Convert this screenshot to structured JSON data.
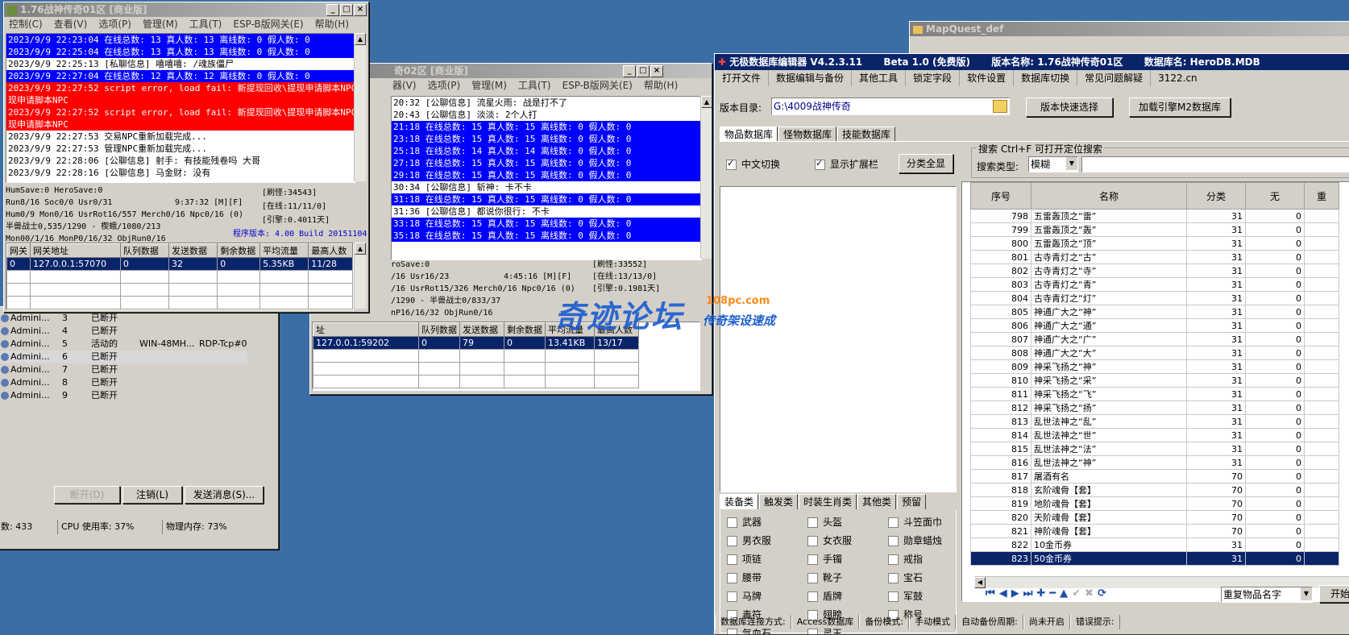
{
  "win1": {
    "title": "1.76战神传奇01区 [商业版]",
    "menu": [
      "控制(C)",
      "查看(V)",
      "选项(P)",
      "管理(M)",
      "工具(T)",
      "ESP-B版网关(E)",
      "帮助(H)"
    ],
    "log": [
      {
        "t": "2023/9/9 22:23:04 在线总数: 13 真人数: 13 离线数: 0 假人数: 0",
        "c": "blue"
      },
      {
        "t": "2023/9/9 22:25:04 在线总数: 13 真人数: 13 离线数: 0 假人数: 0",
        "c": "blue"
      },
      {
        "t": "2023/9/9 22:25:13 [私聊信息] 嘻嘻嘻: /魂族僵尸",
        "c": ""
      },
      {
        "t": "2023/9/9 22:27:04 在线总数: 12 真人数: 12 离线数: 0 假人数: 0",
        "c": "blue"
      },
      {
        "t": "2023/9/9 22:27:52 script error, load fail: 新提现回收\\提现申请脚本NPC.txt@提",
        "c": "red"
      },
      {
        "t": "现申请脚本NPC",
        "c": "red"
      },
      {
        "t": "2023/9/9 22:27:52 script error, load fail: 新提现回收\\提现申请脚本NPC.txt@提",
        "c": "red"
      },
      {
        "t": "现申请脚本NPC",
        "c": "red"
      },
      {
        "t": "2023/9/9 22:27:53 交易NPC重新加载完成...",
        "c": ""
      },
      {
        "t": "2023/9/9 22:27:53 管理NPC重新加载完成...",
        "c": ""
      },
      {
        "t": "2023/9/9 22:28:06 [公聊信息] 射手: 有技能残卷吗 大哥",
        "c": ""
      },
      {
        "t": "2023/9/9 22:28:16 [公聊信息] 马金财: 没有",
        "c": ""
      }
    ],
    "stats": [
      "HumSave:0 HeroSave:0",
      "Run8/16 Soc0/0 Usr0/31",
      "Hum0/9 Mon0/16 UsrRot16/557 Merch0/16 Npc0/16 (0)",
      "半兽战士0,535/1290 - 楔蛾/1080/213",
      "Mon00/1/16 MonP0/16/32 ObjRun0/16"
    ],
    "time": "9:37:32 [M][F]",
    "refresh": "[刷怪:34543]",
    "online": "[在线:11/11/0]",
    "engine": "[引擎:0.4011天]",
    "version": "程序版本: 4.00 Build 20151104",
    "gw_headers": [
      "网关",
      "网关地址",
      "队列数据",
      "发送数据",
      "剩余数据",
      "平均流量",
      "最高人数"
    ],
    "gw_row": [
      "0",
      "127.0.0.1:57070",
      "0",
      "32",
      "0",
      "5.35KB",
      "11/28"
    ]
  },
  "win2": {
    "title": "奇02区 [商业版]",
    "menu": [
      "器(V)",
      "选项(P)",
      "管理(M)",
      "工具(T)",
      "ESP-B版网关(E)",
      "帮助(H)"
    ],
    "log": [
      {
        "t": "20:32 [公聊信息] 流星火雨: 战是打不了",
        "c": ""
      },
      {
        "t": "20:43 [公聊信息] 淡淡: 2个人打",
        "c": ""
      },
      {
        "t": "21:18 在线总数: 15 真人数: 15 离线数: 0 假人数: 0",
        "c": "blue"
      },
      {
        "t": "23:18 在线总数: 15 真人数: 15 离线数: 0 假人数: 0",
        "c": "blue"
      },
      {
        "t": "25:18 在线总数: 14 真人数: 14 离线数: 0 假人数: 0",
        "c": "blue"
      },
      {
        "t": "27:18 在线总数: 15 真人数: 15 离线数: 0 假人数: 0",
        "c": "blue"
      },
      {
        "t": "29:18 在线总数: 15 真人数: 15 离线数: 0 假人数: 0",
        "c": "blue"
      },
      {
        "t": "30:34 [公聊信息] 斩神: 卡不卡",
        "c": ""
      },
      {
        "t": "31:18 在线总数: 15 真人数: 15 离线数: 0 假人数: 0",
        "c": "blue"
      },
      {
        "t": "31:36 [公聊信息] 都说你很行: 不卡",
        "c": ""
      },
      {
        "t": "33:18 在线总数: 15 真人数: 15 离线数: 0 假人数: 0",
        "c": "blue"
      },
      {
        "t": "35:18 在线总数: 15 真人数: 15 离线数: 0 假人数: 0",
        "c": "blue"
      }
    ],
    "stats": [
      "roSave:0",
      "/16 Usr16/23",
      "/16 UsrRot15/326 Merch0/16 Npc0/16 (0)",
      "/1290 - 半兽战士0/833/37",
      "nP16/16/32 ObjRun0/16"
    ],
    "time": "4:45:16 [M][F]",
    "refresh": "[刷怪:33552]",
    "online": "[在线:13/13/0]",
    "engine": "[引擎:0.1981天]",
    "gw_headers": [
      "址",
      "队列数据",
      "发送数据",
      "剩余数据",
      "平均流量",
      "最高人数"
    ],
    "gw_row": [
      "127.0.0.1:59202",
      "0",
      "79",
      "0",
      "13.41KB",
      "13/17"
    ]
  },
  "win3": {
    "sessions": [
      {
        "user": "Admini...",
        "id": "3",
        "state": "已断开",
        "client": "",
        "proto": ""
      },
      {
        "user": "Admini...",
        "id": "4",
        "state": "已断开",
        "client": "",
        "proto": ""
      },
      {
        "user": "Admini...",
        "id": "5",
        "state": "活动的",
        "client": "WIN-48MH...",
        "proto": "RDP-Tcp#0"
      },
      {
        "user": "Admini...",
        "id": "6",
        "state": "已断开",
        "client": "",
        "proto": ""
      },
      {
        "user": "Admini...",
        "id": "7",
        "state": "已断开",
        "client": "",
        "proto": ""
      },
      {
        "user": "Admini...",
        "id": "8",
        "state": "已断开",
        "client": "",
        "proto": ""
      },
      {
        "user": "Admini...",
        "id": "9",
        "state": "已断开",
        "client": "",
        "proto": ""
      }
    ],
    "btn_disconnect": "断开(D)",
    "btn_logoff": "注销(L)",
    "btn_send": "发送消息(S)...",
    "status_count": "数: 433",
    "status_cpu": "CPU 使用率: 37%",
    "status_mem": "物理内存: 73%"
  },
  "mapquest": {
    "title": "MapQuest_def"
  },
  "watermark": {
    "main": "奇迹论坛",
    "url": "108pc.com",
    "sub": "传奇架设速成"
  },
  "editor": {
    "title": "无极数据库编辑器 V4.2.3.11",
    "beta": "Beta 1.0 (免费版)",
    "ver_name": "版本名称: 1.76战神传奇01区",
    "db_name": "数据库名: HeroDB.MDB",
    "menu": [
      "打开文件",
      "数据编辑与备份",
      "其他工具",
      "锁定字段",
      "软件设置",
      "数据库切换",
      "常见问题解疑",
      "3122.cn"
    ],
    "dir_label": "版本目录:",
    "dir_value": "G:\\4009战神传奇",
    "btn_quick": "版本快速选择",
    "btn_load": "加载引擎M2数据库",
    "tabs": [
      "物品数据库",
      "怪物数据库",
      "技能数据库"
    ],
    "chk_cn": "中文切换",
    "chk_ext": "显示扩展栏",
    "btn_all": "分类全显",
    "search_legend": "搜索  Ctrl+F 可打开定位搜索",
    "search_type_label": "搜索类型:",
    "search_type": "模糊",
    "cat_tabs": [
      "装备类",
      "触发类",
      "时装生肖类",
      "其他类",
      "预留"
    ],
    "categories": [
      "武器",
      "头盔",
      "斗笠面巾",
      "男衣服",
      "女衣服",
      "勋章蜡烛",
      "项链",
      "手镯",
      "戒指",
      "腰带",
      "靴子",
      "宝石",
      "马牌",
      "盾牌",
      "军鼓",
      "毒符",
      "翅膀",
      "称号",
      "气血石",
      "灵玉"
    ],
    "cols": [
      "序号",
      "名称",
      "分类",
      "无",
      "重"
    ],
    "rows": [
      [
        "798",
        "五雷轰顶之“雷”",
        "31",
        "0"
      ],
      [
        "799",
        "五雷轰顶之“轰”",
        "31",
        "0"
      ],
      [
        "800",
        "五雷轰顶之“顶”",
        "31",
        "0"
      ],
      [
        "801",
        "古寺青灯之“古”",
        "31",
        "0"
      ],
      [
        "802",
        "古寺青灯之“寺”",
        "31",
        "0"
      ],
      [
        "803",
        "古寺青灯之“青”",
        "31",
        "0"
      ],
      [
        "804",
        "古寺青灯之“灯”",
        "31",
        "0"
      ],
      [
        "805",
        "神通广大之“神”",
        "31",
        "0"
      ],
      [
        "806",
        "神通广大之“通”",
        "31",
        "0"
      ],
      [
        "807",
        "神通广大之“广”",
        "31",
        "0"
      ],
      [
        "808",
        "神通广大之“大”",
        "31",
        "0"
      ],
      [
        "809",
        "神采飞扬之“神”",
        "31",
        "0"
      ],
      [
        "810",
        "神采飞扬之“采”",
        "31",
        "0"
      ],
      [
        "811",
        "神采飞扬之“飞”",
        "31",
        "0"
      ],
      [
        "812",
        "神采飞扬之“扬”",
        "31",
        "0"
      ],
      [
        "813",
        "乱世法神之“乱”",
        "31",
        "0"
      ],
      [
        "814",
        "乱世法神之“世”",
        "31",
        "0"
      ],
      [
        "815",
        "乱世法神之“法”",
        "31",
        "0"
      ],
      [
        "816",
        "乱世法神之“神”",
        "31",
        "0"
      ],
      [
        "817",
        "屠酒有名",
        "70",
        "0"
      ],
      [
        "818",
        "玄阶魂骨【套】",
        "70",
        "0"
      ],
      [
        "819",
        "地阶魂骨【套】",
        "70",
        "0"
      ],
      [
        "820",
        "天阶魂骨【套】",
        "70",
        "0"
      ],
      [
        "821",
        "神阶魂骨【套】",
        "70",
        "0"
      ],
      [
        "822",
        "10金币券",
        "31",
        "0"
      ],
      [
        "823",
        "50金币券",
        "31",
        "0"
      ]
    ],
    "dup_select": "重复物品名字",
    "btn_start": "开始",
    "status": [
      "数据库连接方式:",
      "Access数据库",
      "备份模式:",
      "手动模式",
      "自动备份周期:",
      "尚未开启",
      "错误提示:"
    ]
  }
}
